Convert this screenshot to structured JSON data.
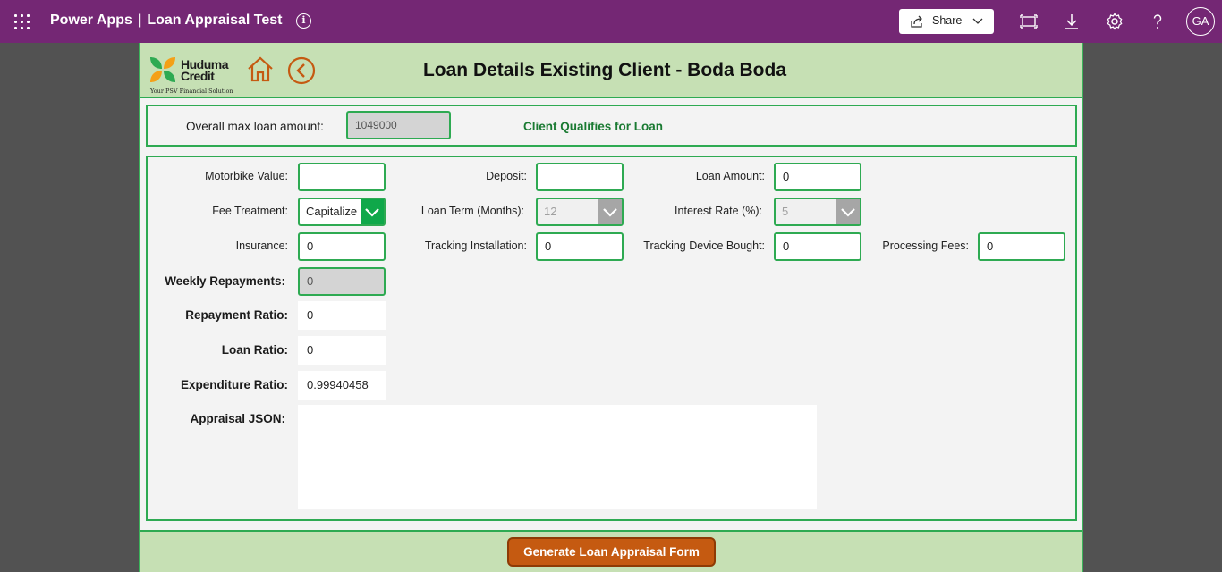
{
  "topbar": {
    "app_name": "Power Apps",
    "separator": "|",
    "app_title": "Loan Appraisal Test",
    "share_label": "Share",
    "avatar_initials": "GA",
    "bg_color": "#742774"
  },
  "header": {
    "logo_line1": "Huduma",
    "logo_line2": "Credit",
    "logo_tagline": "Your PSV Financial Solution",
    "title": "Loan Details Existing Client - Boda Boda"
  },
  "summary": {
    "overall_max_label": "Overall max loan amount:",
    "overall_max_value": "1049000",
    "qualification_status": "Client Qualifies for Loan"
  },
  "form": {
    "motorbike_value": {
      "label": "Motorbike Value:",
      "value": ""
    },
    "deposit": {
      "label": "Deposit:",
      "value": ""
    },
    "loan_amount": {
      "label": "Loan Amount:",
      "value": "0"
    },
    "fee_treatment": {
      "label": "Fee Treatment:",
      "value": "Capitalize"
    },
    "loan_term": {
      "label": "Loan Term (Months):",
      "value": "12"
    },
    "interest_rate": {
      "label": "Interest Rate (%):",
      "value": "5"
    },
    "insurance": {
      "label": "Insurance:",
      "value": "0"
    },
    "tracking_installation": {
      "label": "Tracking Installation:",
      "value": "0"
    },
    "tracking_device": {
      "label": "Tracking Device Bought:",
      "value": "0"
    },
    "processing_fees": {
      "label": "Processing Fees:",
      "value": "0"
    },
    "weekly_repayments": {
      "label": "Weekly Repayments:",
      "value": "0"
    },
    "repayment_ratio": {
      "label": "Repayment Ratio:",
      "value": "0"
    },
    "loan_ratio": {
      "label": "Loan Ratio:",
      "value": "0"
    },
    "expenditure_ratio": {
      "label": "Expenditure Ratio:",
      "value": "0.99940458"
    },
    "appraisal_json": {
      "label": "Appraisal JSON:",
      "value": ""
    }
  },
  "footer": {
    "generate_label": "Generate Loan Appraisal Form"
  },
  "colors": {
    "accent_green": "#2eaa52",
    "header_green": "#c6e0b4",
    "button_orange": "#c55a11"
  }
}
